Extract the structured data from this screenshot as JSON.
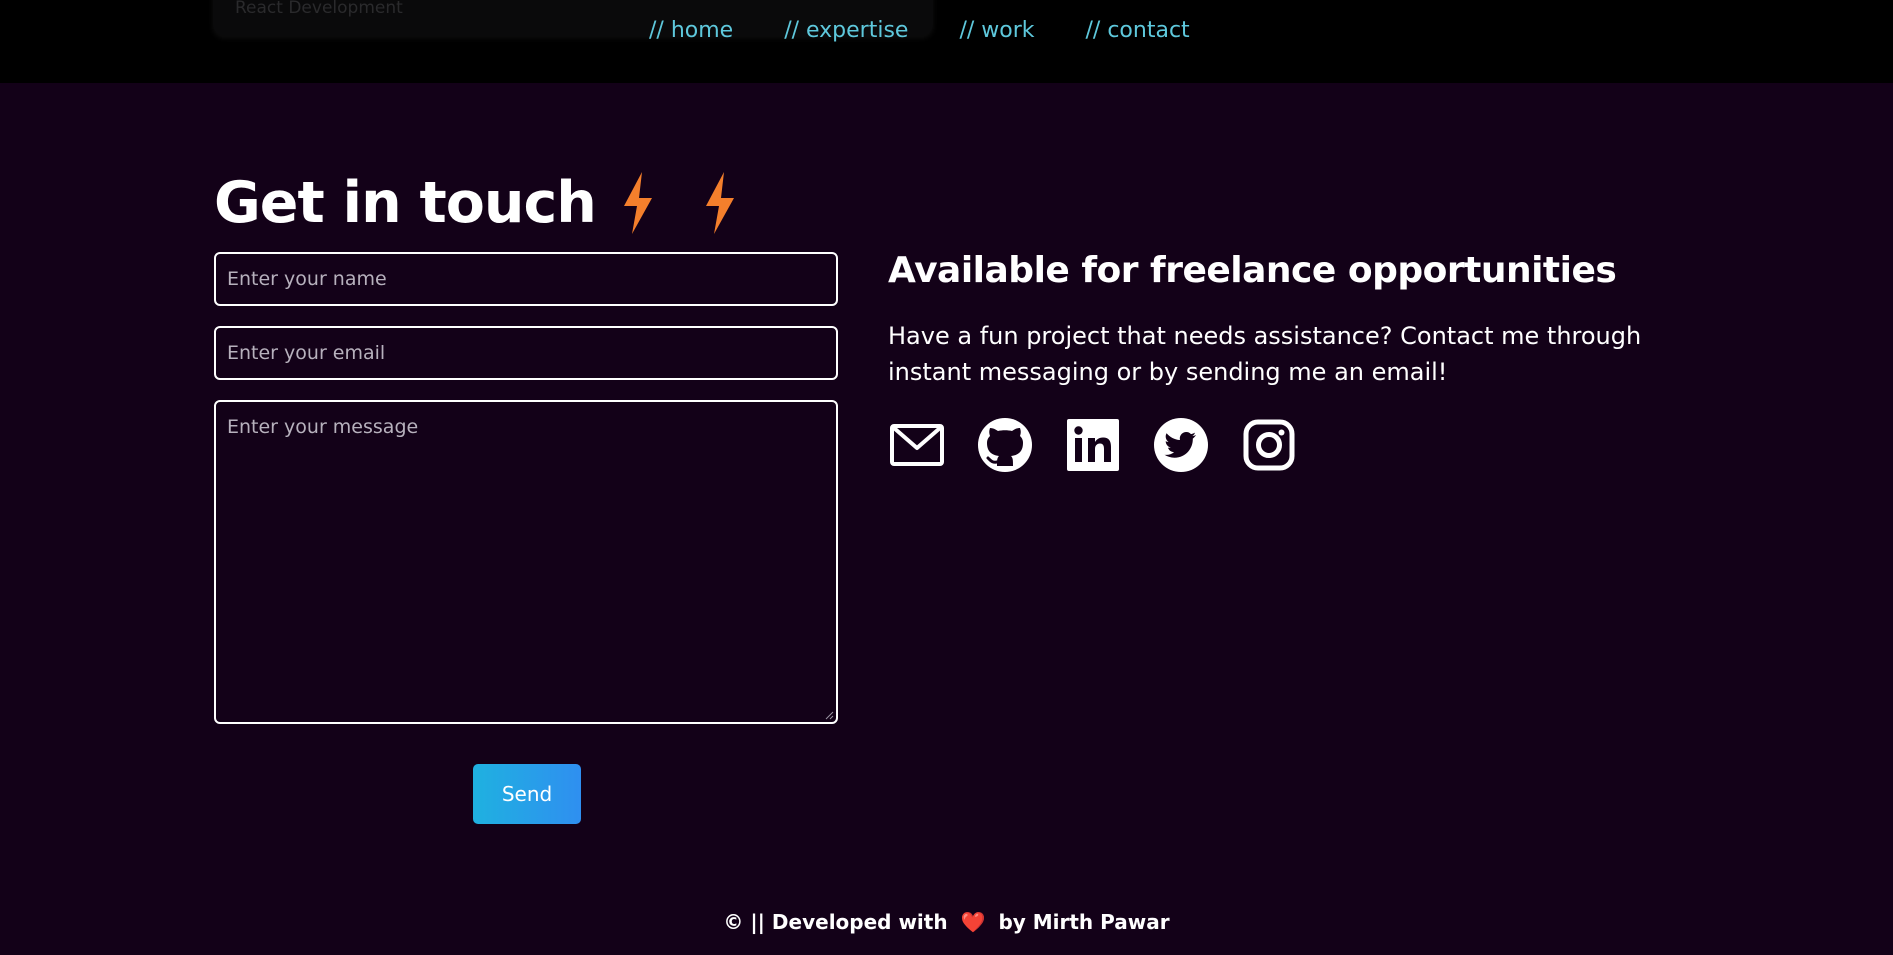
{
  "header": {
    "ghost_card_text": "React Development",
    "nav": [
      {
        "label": "// home"
      },
      {
        "label": "// expertise"
      },
      {
        "label": "// work"
      },
      {
        "label": "// contact"
      }
    ]
  },
  "contact": {
    "heading": "Get in touch",
    "heading_icons": [
      "lightning-bolt-icon",
      "lightning-bolt-icon"
    ],
    "name_placeholder": "Enter your name",
    "email_placeholder": "Enter your email",
    "message_placeholder": "Enter your message",
    "send_label": "Send"
  },
  "freelance": {
    "title": "Available for freelance opportunities",
    "text": "Have a fun project that needs assistance? Contact me through instant messaging or by sending me an email!",
    "socials": [
      "mail-icon",
      "github-icon",
      "linkedin-icon",
      "twitter-icon",
      "instagram-icon"
    ]
  },
  "footer": {
    "prefix": "© || Developed with",
    "heart": "❤️",
    "suffix": "by Mirth Pawar"
  },
  "colors": {
    "background": "#130118",
    "navbar": "#000000",
    "nav_link": "#5ec8dc",
    "bolt": "#f47f2c",
    "button_gradient_start": "#1fb1e0",
    "button_gradient_end": "#2f8ff0",
    "heart": "#e5283b"
  }
}
